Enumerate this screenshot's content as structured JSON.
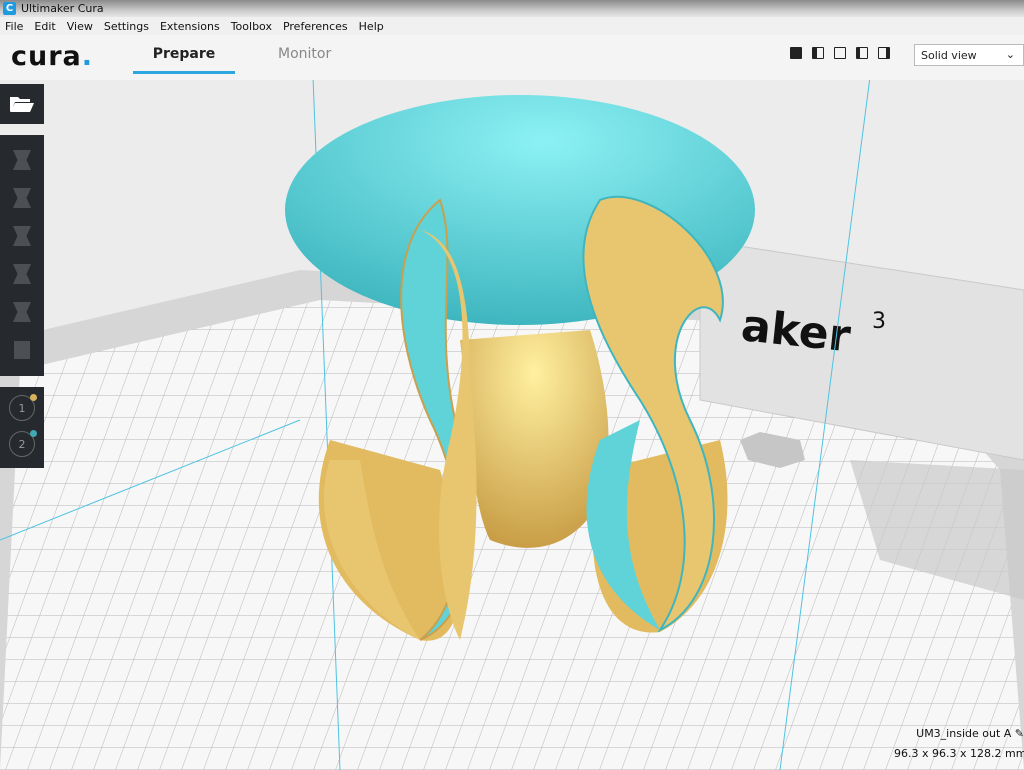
{
  "window": {
    "title": "Ultimaker Cura",
    "icon_letter": "C"
  },
  "menu": [
    "File",
    "Edit",
    "View",
    "Settings",
    "Extensions",
    "Toolbox",
    "Preferences",
    "Help"
  ],
  "header": {
    "logo": "cura",
    "tabs": [
      {
        "label": "Prepare",
        "active": true
      },
      {
        "label": "Monitor",
        "active": false
      }
    ],
    "view_buttons": [
      "3d-view",
      "front-view",
      "top-view",
      "left-view",
      "right-view"
    ],
    "view_mode": "Solid view"
  },
  "toolbar": {
    "open": "open-file",
    "tools": [
      "move",
      "scale",
      "rotate",
      "mirror",
      "per-model-settings",
      "support-blocker"
    ]
  },
  "extruders": [
    {
      "label": "1",
      "color": "#d8b25a"
    },
    {
      "label": "2",
      "color": "#3fa9b5"
    }
  ],
  "build_plate": {
    "printer_label": "aker",
    "printer_number": "3"
  },
  "object": {
    "name": "UM3_inside out A",
    "dimensions": "96.3 x 96.3 x 128.2 mm"
  },
  "colors": {
    "accent": "#2da6e0",
    "model_outside": "#5fd3d8",
    "model_inside": "#e8c670"
  }
}
